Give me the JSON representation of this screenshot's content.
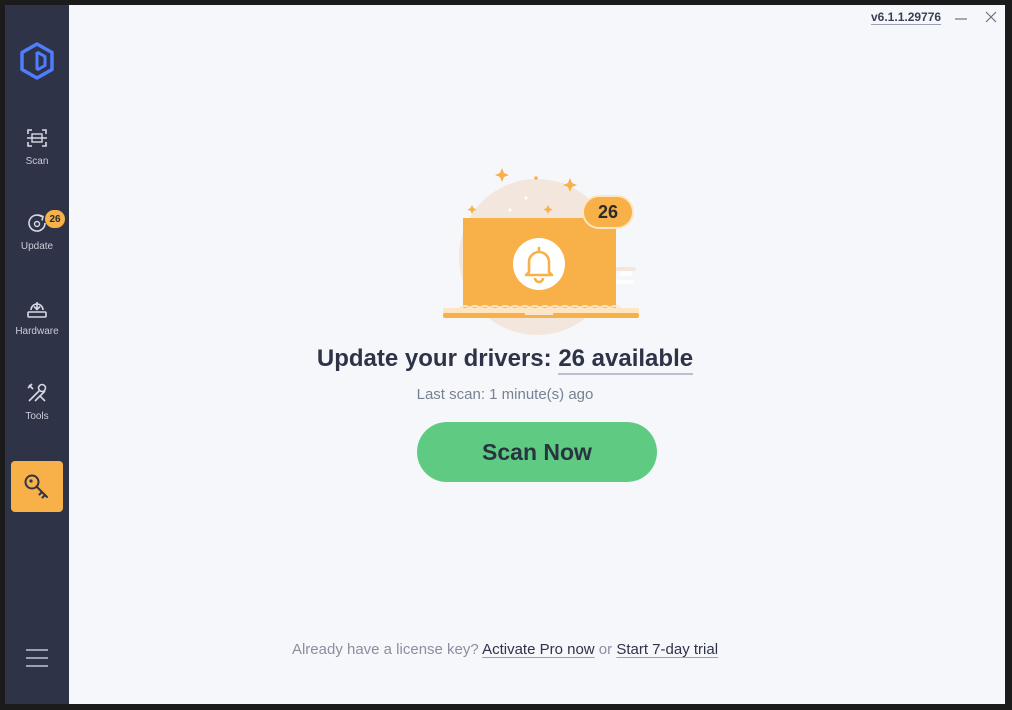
{
  "window": {
    "version": "v6.1.1.29776"
  },
  "sidebar": {
    "items": [
      {
        "label": "Scan"
      },
      {
        "label": "Update",
        "badge": "26"
      },
      {
        "label": "Hardware"
      },
      {
        "label": "Tools"
      }
    ]
  },
  "main": {
    "illustration_badge": "26",
    "headline_prefix": "Update your drivers: ",
    "headline_count": "26 available",
    "last_scan": "Last scan: 1 minute(s) ago",
    "scan_button": "Scan Now",
    "footer": {
      "question": "Already have a license key? ",
      "activate_link": "Activate Pro now",
      "or": " or ",
      "trial_link": "Start 7-day trial"
    }
  },
  "colors": {
    "sidebar": "#2f3348",
    "accent_orange": "#f8b148",
    "scan_green": "#5fcb82",
    "background": "#f5f7fa"
  }
}
